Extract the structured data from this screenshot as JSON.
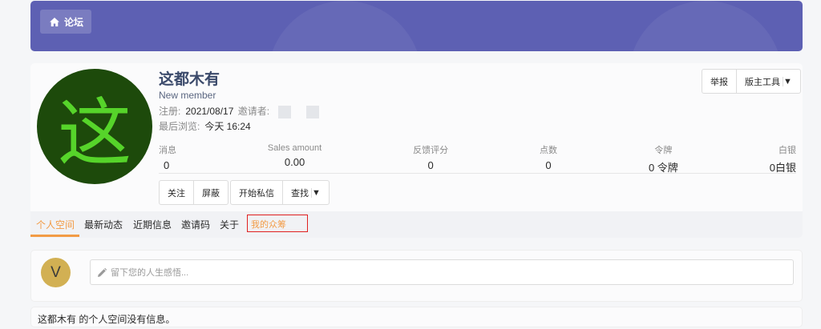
{
  "banner": {
    "forum_label": "论坛",
    "icon": "home-icon",
    "color": "#5d60b3"
  },
  "profile": {
    "avatar_char": "这",
    "name": "这都木有",
    "title": "New member",
    "reg_label": "注册:",
    "reg_value": "2021/08/17",
    "inviter_label": "邀请者:",
    "seen_label": "最后浏览:",
    "seen_value": "今天 16:24"
  },
  "stats": [
    {
      "label": "消息",
      "value": "0"
    },
    {
      "label": "Sales amount",
      "value": "0.00"
    },
    {
      "label": "反馈评分",
      "value": "0"
    },
    {
      "label": "点数",
      "value": "0"
    },
    {
      "label": "令牌",
      "value": "0 令牌"
    },
    {
      "label": "白银",
      "value": "0白银"
    }
  ],
  "actions": {
    "follow": "关注",
    "block": "屏蔽",
    "message": "开始私信",
    "find": "查找"
  },
  "tools": {
    "report": "举报",
    "mod_tools": "版主工具"
  },
  "tabs": [
    {
      "label": "个人空间"
    },
    {
      "label": "最新动态"
    },
    {
      "label": "近期信息"
    },
    {
      "label": "邀请码"
    },
    {
      "label": "关于"
    },
    {
      "label": "我的众筹"
    }
  ],
  "status_update": {
    "avatar_char": "V",
    "placeholder": "留下您的人生感悟..."
  },
  "empty_message": "这都木有 的个人空间没有信息。",
  "colors": {
    "accent": "#f29b45",
    "highlight_border": "#e02020"
  }
}
